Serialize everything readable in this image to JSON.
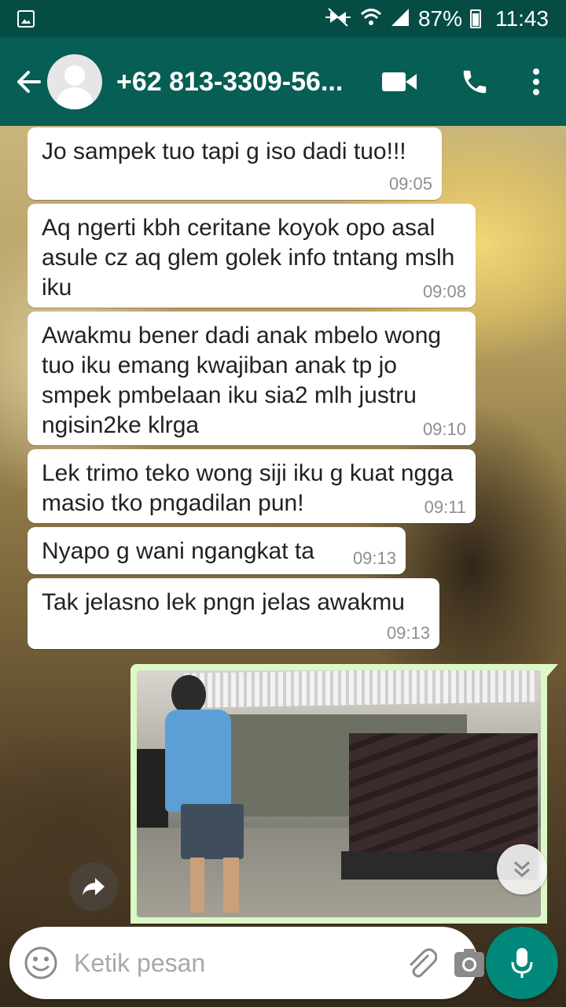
{
  "status_bar": {
    "battery": "87%",
    "time": "11:43",
    "icons": [
      "gallery-icon",
      "mute-icon",
      "wifi-icon",
      "signal-icon",
      "battery-icon"
    ]
  },
  "header": {
    "contact": "+62 813-3309-56...",
    "icons": [
      "back-arrow-icon",
      "video-call-icon",
      "phone-icon",
      "more-vert-icon"
    ]
  },
  "messages": [
    {
      "text": "Jo sampek tuo tapi g iso dadi tuo!!!",
      "time": "09:05"
    },
    {
      "text": "Aq ngerti kbh ceritane koyok opo asal asule cz aq glem golek info tntang mslh iku",
      "time": "09:08"
    },
    {
      "text": "Awakmu bener dadi anak mbelo wong tuo iku emang kwajiban anak tp jo smpek pmbelaan iku sia2 mlh justru ngisin2ke klrga",
      "time": "09:10"
    },
    {
      "text": "Lek trimo teko wong siji iku g kuat ngga masio tko pngadilan pun!",
      "time": "09:11"
    },
    {
      "text": "Nyapo g wani ngangkat ta",
      "time": "09:13"
    },
    {
      "text": "Tak jelasno lek pngn jelas awakmu",
      "time": "09:13"
    }
  ],
  "input": {
    "placeholder": "Ketik pesan",
    "icons": [
      "emoji-icon",
      "attach-icon",
      "camera-icon",
      "mic-icon"
    ]
  },
  "colors": {
    "status_bar": "#054d44",
    "app_bar": "#075e54",
    "outgoing_bubble": "#dcf8c6",
    "mic_button": "#00897b"
  }
}
